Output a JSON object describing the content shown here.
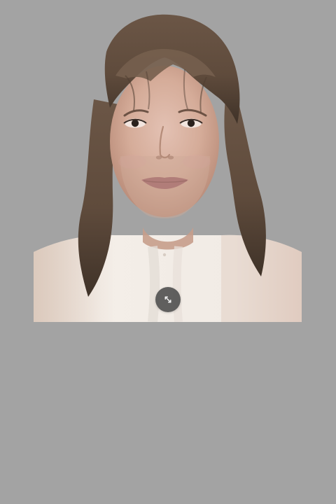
{
  "screen": {
    "background_color": "#a3a3a3"
  },
  "photo": {
    "subject": "portrait-photo",
    "colors": {
      "skin": "#d8b3a2",
      "hair": "#5e4a3a",
      "shirt": "#f4eee8"
    }
  },
  "controls": {
    "resize_icon": "expand-arrows-icon",
    "resize_button_color": "#4b4b4b"
  }
}
